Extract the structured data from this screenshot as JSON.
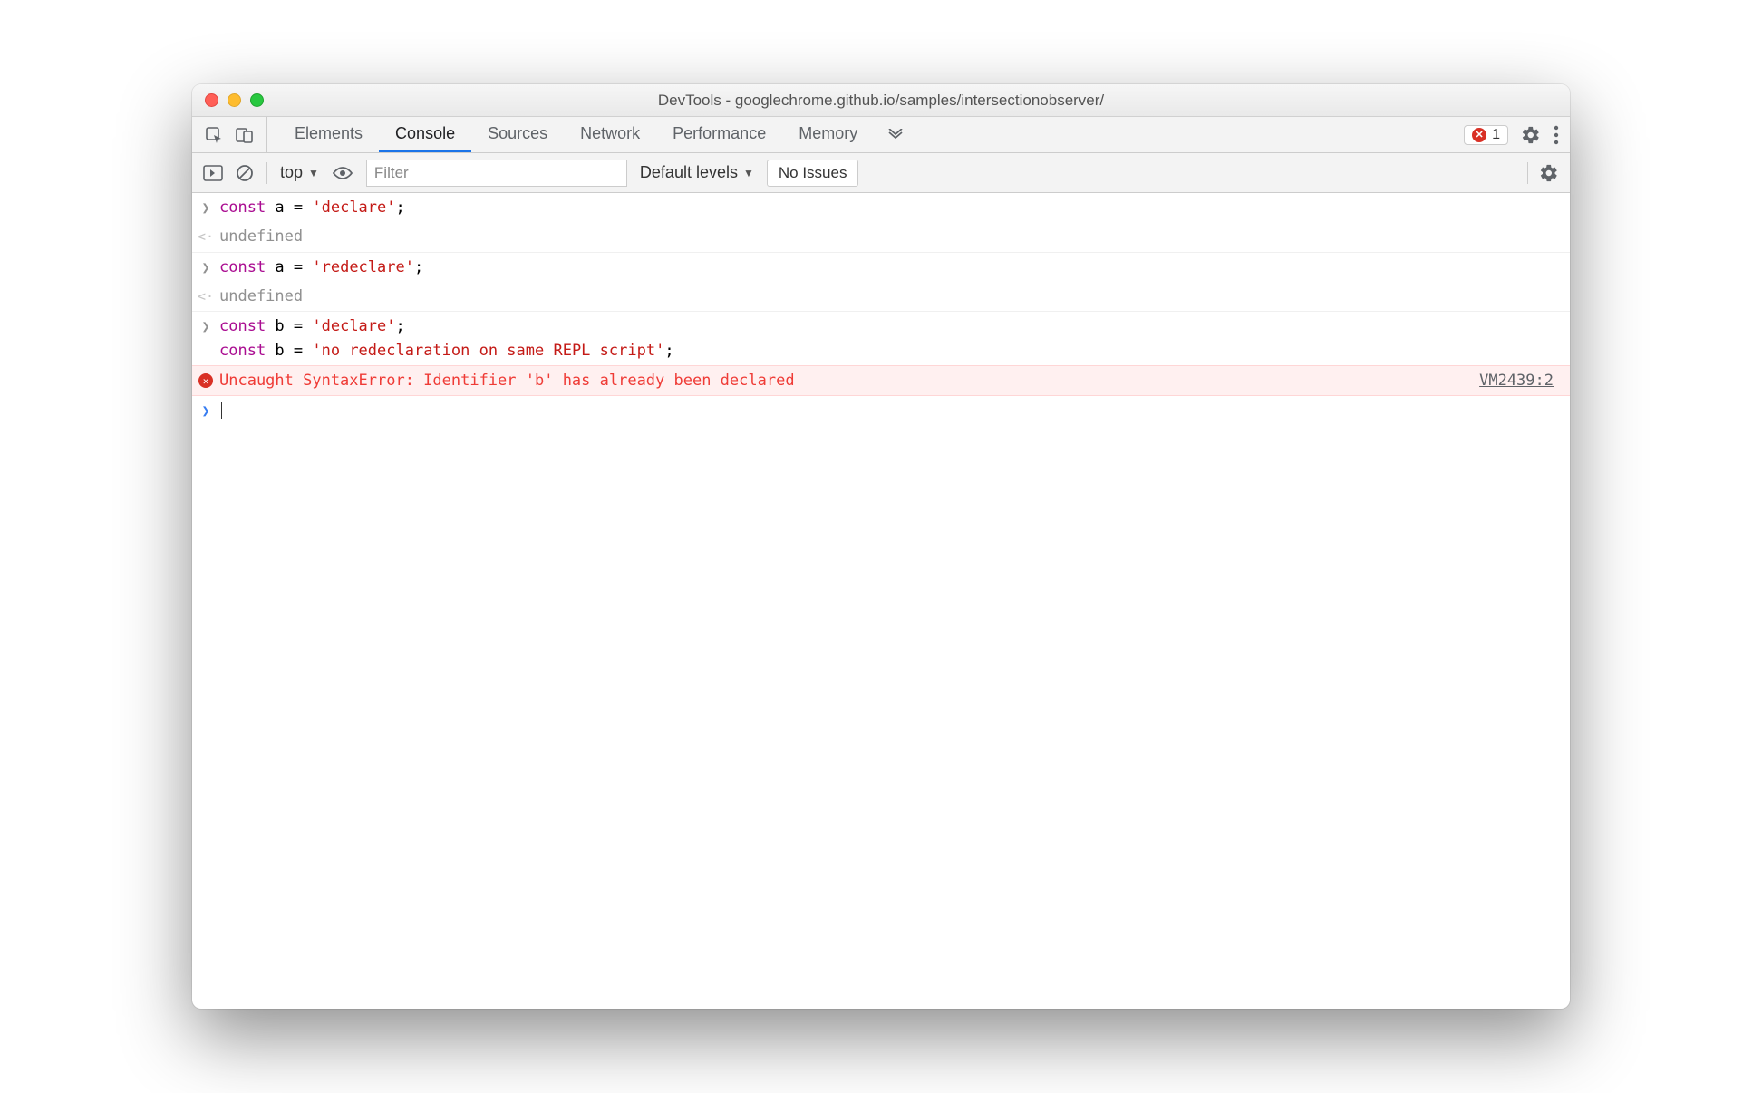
{
  "window": {
    "title": "DevTools - googlechrome.github.io/samples/intersectionobserver/"
  },
  "tabs": {
    "items": [
      "Elements",
      "Console",
      "Sources",
      "Network",
      "Performance",
      "Memory"
    ],
    "active_index": 1,
    "error_count": "1"
  },
  "console_toolbar": {
    "context": "top",
    "filter_placeholder": "Filter",
    "levels_label": "Default levels",
    "issues_label": "No Issues"
  },
  "console": {
    "entries": [
      {
        "type": "input",
        "tokens": [
          [
            "kw",
            "const"
          ],
          [
            "txt",
            " a = "
          ],
          [
            "str",
            "'declare'"
          ],
          [
            "txt",
            ";"
          ]
        ]
      },
      {
        "type": "return",
        "text": "undefined"
      },
      {
        "type": "input",
        "tokens": [
          [
            "kw",
            "const"
          ],
          [
            "txt",
            " a = "
          ],
          [
            "str",
            "'redeclare'"
          ],
          [
            "txt",
            ";"
          ]
        ]
      },
      {
        "type": "return",
        "text": "undefined"
      },
      {
        "type": "input",
        "lines": [
          [
            [
              "kw",
              "const"
            ],
            [
              "txt",
              " b = "
            ],
            [
              "str",
              "'declare'"
            ],
            [
              "txt",
              ";"
            ]
          ],
          [
            [
              "kw",
              "const"
            ],
            [
              "txt",
              " b = "
            ],
            [
              "str",
              "'no redeclaration on same REPL script'"
            ],
            [
              "txt",
              ";"
            ]
          ]
        ]
      },
      {
        "type": "error",
        "text": "Uncaught SyntaxError: Identifier 'b' has already been declared",
        "source": "VM2439:2"
      }
    ]
  }
}
